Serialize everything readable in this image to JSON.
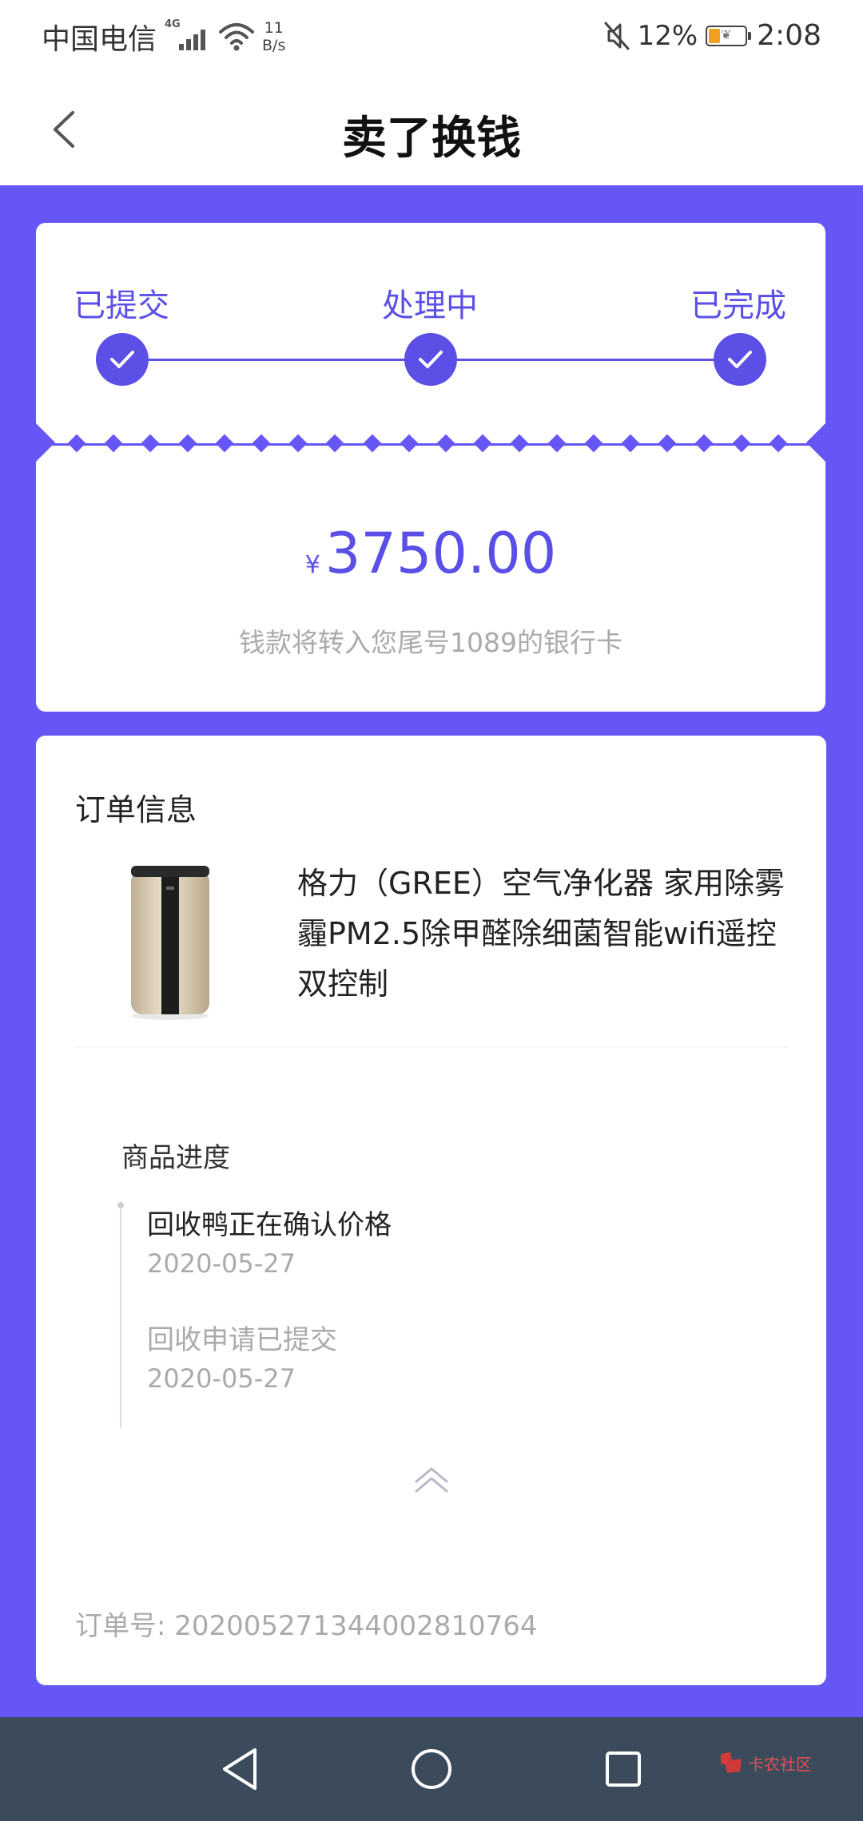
{
  "status_bar": {
    "carrier": "中国电信",
    "network_type": "4G",
    "speed_value": "11",
    "speed_unit": "B/s",
    "battery_percent": "12%",
    "time": "2:08"
  },
  "header": {
    "title": "卖了换钱",
    "back_icon": "chevron-left-icon"
  },
  "steps": [
    {
      "label": "已提交",
      "completed": true
    },
    {
      "label": "处理中",
      "completed": true
    },
    {
      "label": "已完成",
      "completed": true
    }
  ],
  "payout": {
    "currency": "¥",
    "amount": "3750.00",
    "note": "钱款将转入您尾号1089的银行卡"
  },
  "order": {
    "section_title": "订单信息",
    "product_name": "格力（GREE）空气净化器 家用除雾霾PM2.5除甲醛除细菌智能wifi遥控双控制",
    "progress_title": "商品进度",
    "timeline": [
      {
        "text": "回收鸭正在确认价格",
        "date": "2020-05-27"
      },
      {
        "text": "回收申请已提交",
        "date": "2020-05-27"
      }
    ],
    "collapse_icon": "double-chevron-up-icon",
    "order_number": "订单号: 202005271344002810764"
  },
  "nav_bar": {
    "buttons": [
      "back-triangle-icon",
      "home-circle-icon",
      "recents-square-icon"
    ],
    "watermark": "卡农社区"
  },
  "colors": {
    "accent": "#5b4fe6",
    "background": "#6556f5",
    "nav_bar": "#3c4b5c"
  }
}
